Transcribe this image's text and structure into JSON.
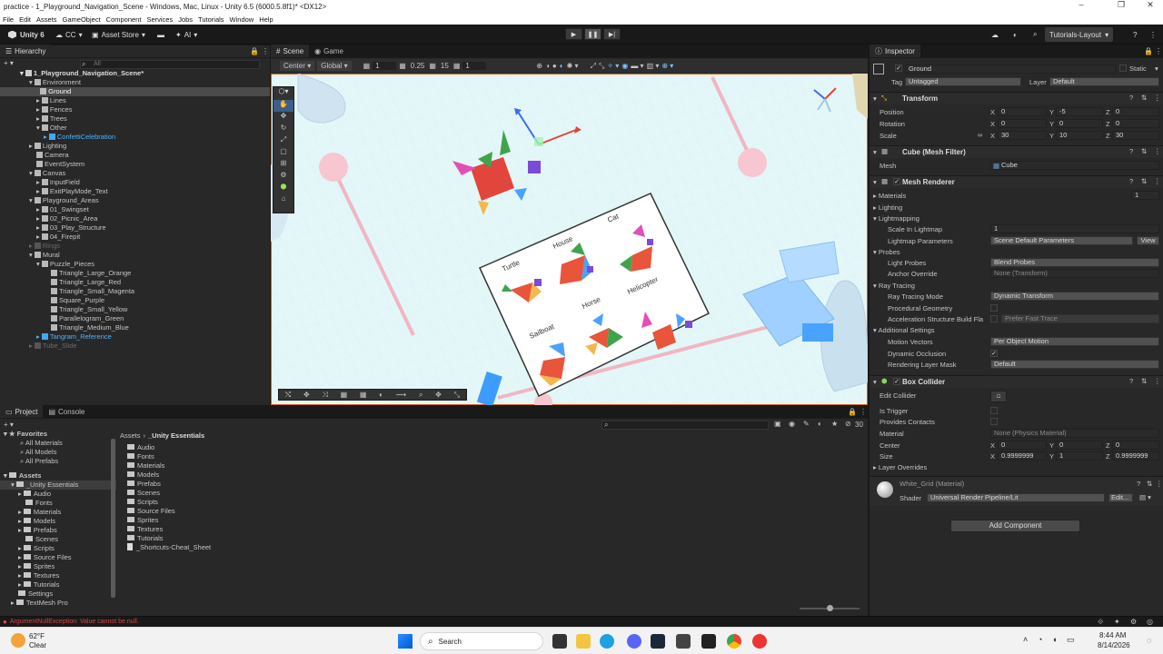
{
  "window": {
    "title": "practice - 1_Playground_Navigation_Scene - Windows, Mac, Linux - Unity 6.5 (6000.5.8f1)* <DX12>"
  },
  "menu": [
    "File",
    "Edit",
    "Assets",
    "GameObject",
    "Component",
    "Services",
    "Jobs",
    "Tutorials",
    "Window",
    "Help"
  ],
  "toolbar": {
    "account": "Unity 6",
    "cc": "CC",
    "asset_store": "Asset Store",
    "ai": "AI",
    "layout": "Tutorials-Layout"
  },
  "hierarchy": {
    "tab": "Hierarchy",
    "search_placeholder": "All",
    "scene": "1_Playground_Navigation_Scene*",
    "items": [
      {
        "label": "Environment"
      },
      {
        "label": "Ground"
      },
      {
        "label": "Lines"
      },
      {
        "label": "Fences"
      },
      {
        "label": "Trees"
      },
      {
        "label": "Other"
      },
      {
        "label": "ConfettiCelebration"
      },
      {
        "label": "Lighting"
      },
      {
        "label": "Camera"
      },
      {
        "label": "EventSystem"
      },
      {
        "label": "Canvas"
      },
      {
        "label": "InputField"
      },
      {
        "label": "ExitPlayMode_Text"
      },
      {
        "label": "Playground_Areas"
      },
      {
        "label": "01_Swingset"
      },
      {
        "label": "02_Picnic_Area"
      },
      {
        "label": "03_Play_Structure"
      },
      {
        "label": "04_Firepit"
      },
      {
        "label": "Rings"
      },
      {
        "label": "Mural"
      },
      {
        "label": "Puzzle_Pieces"
      },
      {
        "label": "Triangle_Large_Orange"
      },
      {
        "label": "Triangle_Large_Red"
      },
      {
        "label": "Triangle_Small_Magenta"
      },
      {
        "label": "Square_Purple"
      },
      {
        "label": "Triangle_Small_Yellow"
      },
      {
        "label": "Parallelogram_Green"
      },
      {
        "label": "Triangle_Medium_Blue"
      },
      {
        "label": "Tangram_Reference"
      },
      {
        "label": "Tube_Slide"
      }
    ]
  },
  "scene_view": {
    "tabs": [
      "Scene",
      "Game"
    ],
    "pivot": "Center",
    "space": "Global",
    "grid_snap": "1",
    "move_snap": "0.25",
    "rotate_snap": "15",
    "scale_snap": "1",
    "mural_labels": [
      "Turtle",
      "House",
      "Cat",
      "Horse",
      "Helicopter",
      "Sailboat"
    ]
  },
  "inspector": {
    "tab": "Inspector",
    "name": "Ground",
    "static_label": "Static",
    "tag_label": "Tag",
    "tag": "Untagged",
    "layer_label": "Layer",
    "layer": "Default",
    "transform": {
      "title": "Transform",
      "position_label": "Position",
      "position": [
        "0",
        "-5",
        "0"
      ],
      "rotation_label": "Rotation",
      "rotation": [
        "0",
        "0",
        "0"
      ],
      "scale_label": "Scale",
      "scale": [
        "30",
        "10",
        "30"
      ]
    },
    "axes": [
      "X",
      "Y",
      "Z"
    ],
    "mesh_filter": {
      "title": "Cube (Mesh Filter)",
      "mesh_label": "Mesh",
      "mesh": "Cube"
    },
    "mesh_renderer": {
      "title": "Mesh Renderer",
      "materials_label": "Materials",
      "materials_count": "1",
      "lighting": "Lighting",
      "lightmapping": "Lightmapping",
      "scale_lightmap_label": "Scale In Lightmap",
      "scale_lightmap": "1",
      "lightmap_params_label": "Lightmap Parameters",
      "lightmap_params": "Scene Default Parameters",
      "view_button": "View",
      "probes": "Probes",
      "light_probes_label": "Light Probes",
      "light_probes": "Blend Probes",
      "anchor_label": "Anchor Override",
      "anchor": "None (Transform)",
      "ray_tracing": "Ray Tracing",
      "rt_mode_label": "Ray Tracing Mode",
      "rt_mode": "Dynamic Transform",
      "proc_geo_label": "Procedural Geometry",
      "accel_label": "Acceleration Structure Build Fla",
      "accel": "Prefer Fast Trace",
      "additional": "Additional Settings",
      "motion_label": "Motion Vectors",
      "motion": "Per Object Motion",
      "occlusion_label": "Dynamic Occlusion",
      "mask_label": "Rendering Layer Mask",
      "mask": "Default"
    },
    "box_collider": {
      "title": "Box Collider",
      "edit_label": "Edit Collider",
      "trigger_label": "Is Trigger",
      "contacts_label": "Provides Contacts",
      "material_label": "Material",
      "material": "None (Physics Material)",
      "center_label": "Center",
      "center": [
        "0",
        "0",
        "0"
      ],
      "size_label": "Size",
      "size": [
        "0.9999999",
        "1",
        "0.9999999"
      ],
      "overrides_label": "Layer Overrides"
    },
    "material": {
      "name": "White_Grid (Material)",
      "shader_label": "Shader",
      "shader": "Universal Render Pipeline/Lit",
      "edit": "Edit..."
    },
    "add_component": "Add Component"
  },
  "project": {
    "tabs": [
      "Project",
      "Console"
    ],
    "favorites_label": "Favorites",
    "favorites": [
      "All Materials",
      "All Models",
      "All Prefabs"
    ],
    "assets_label": "Assets",
    "tree": [
      "_Unity Essentials",
      "Audio",
      "Fonts",
      "Materials",
      "Models",
      "Prefabs",
      "Scenes",
      "Scripts",
      "Source Files",
      "Sprites",
      "Textures",
      "Tutorials",
      "Settings",
      "TextMesh Pro"
    ],
    "breadcrumb": [
      "Assets",
      "_Unity Essentials"
    ],
    "contents": [
      "Audio",
      "Fonts",
      "Materials",
      "Models",
      "Prefabs",
      "Scenes",
      "Scripts",
      "Source Files",
      "Sprites",
      "Textures",
      "Tutorials",
      "_Shortcuts-Cheat_Sheet"
    ],
    "count": "30"
  },
  "status": {
    "error": "ArgumentNullException: Value cannot be null."
  },
  "taskbar": {
    "temp": "62°F",
    "weather": "Clear",
    "search": "Search",
    "time": "8:44 AM",
    "date": "8/14/2026"
  }
}
